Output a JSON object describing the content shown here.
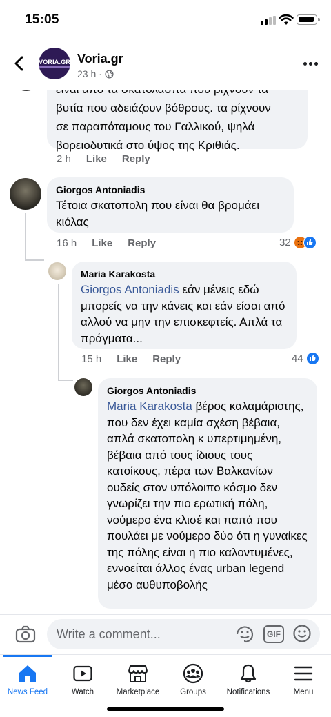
{
  "status_bar": {
    "time": "15:05"
  },
  "header": {
    "page_name": "Voria.gr",
    "post_time": "23 h ·",
    "logo_text": "VORIA.GR"
  },
  "comments": [
    {
      "id": "c0",
      "text": "είναι από τα σκατόλασπα που ρίχνουν τα βυτία που αδειάζουν βόθρους. τα ρίχνουν σε παραπόταμους του Γαλλικού, ψηλά βορειοδυτικά στο ύψος της Κριθιάς.",
      "text_line1": "είναι από τα σκατόλασπα που ρίχνουν τα",
      "text_line2": "βυτία που αδειάζουν βόθρους. τα ρίχνουν",
      "text_line3": "σε παραπόταμους του Γαλλικού, ψηλά",
      "text_line4": "βορειοδυτικά στο ύψος της Κριθιάς.",
      "time": "2 h",
      "like": "Like",
      "reply": "Reply"
    },
    {
      "id": "c1",
      "author": "Giorgos Antoniadis",
      "text": "Τέτοια σκατοπολη που είναι θα βρομάει κιόλας",
      "time": "16 h",
      "like": "Like",
      "reply": "Reply",
      "reaction_count": "32"
    },
    {
      "id": "c2",
      "author": "Maria Karakosta",
      "mention": "Giorgos Antoniadis",
      "text": " εάν μένεις εδώ μπορείς να την κάνεις και εάν είσαι από αλλού να μην την επισκεφτείς. Απλά τα πράγματα...",
      "time": "15 h",
      "like": "Like",
      "reply": "Reply",
      "reaction_count": "44"
    },
    {
      "id": "c3",
      "author": "Giorgos Antoniadis",
      "mention": "Maria Karakosta",
      "text": " βέρος καλαμάριοτης, που δεν έχει καμία σχέση βέβαια, απλά σκατοπολη κ υπερτιμημένη, βέβαια από τους ίδιους τους κατοίκους, πέρα των Βαλκανίων ουδείς στον υπόλοιπο κόσμο δεν γνωρίζει την πιο ερωτική πόλη, νούμερο ένα κλισέ και παπά που πουλάει με νούμερο δύο ότι η γυναίκες της πόλης είναι η πιο καλοντυμένες, εννοείται άλλος ένας urban legend μέσο αυθυποβολής"
    }
  ],
  "composer": {
    "placeholder": "Write a comment...",
    "gif_label": "GIF"
  },
  "bottom_nav": [
    {
      "label": "News Feed",
      "icon": "home-icon",
      "active": true
    },
    {
      "label": "Watch",
      "icon": "watch-icon"
    },
    {
      "label": "Marketplace",
      "icon": "marketplace-icon"
    },
    {
      "label": "Groups",
      "icon": "groups-icon"
    },
    {
      "label": "Notifications",
      "icon": "bell-icon"
    },
    {
      "label": "Menu",
      "icon": "menu-icon"
    }
  ],
  "colors": {
    "accent": "#1877f2",
    "bubble": "#f0f2f5",
    "mention": "#385898",
    "secondary_text": "#65676b"
  }
}
